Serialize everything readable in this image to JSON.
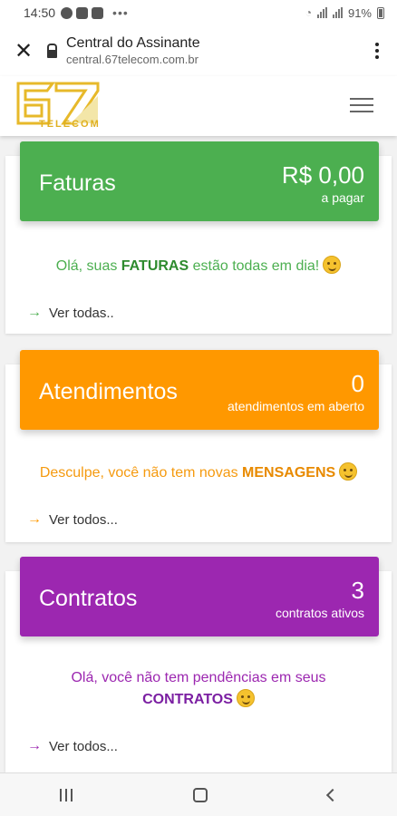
{
  "statusbar": {
    "time": "14:50",
    "battery": "91%"
  },
  "browser": {
    "title": "Central do Assinante",
    "url": "central.67telecom.com.br"
  },
  "logo": {
    "number": "67",
    "text": "TELECOM"
  },
  "cards": {
    "faturas": {
      "title": "Faturas",
      "value": "R$ 0,00",
      "sub": "a pagar",
      "msg_before": "Olá, suas ",
      "msg_strong": "FATURAS",
      "msg_after": " estão todas em dia!",
      "link": "Ver todas..",
      "color": "#4caf50",
      "text_color": "#4caf50"
    },
    "atendimentos": {
      "title": "Atendimentos",
      "value": "0",
      "sub": "atendimentos em aberto",
      "msg_before": "Desculpe, você não tem novas ",
      "msg_strong": "MENSAGENS",
      "msg_after": "",
      "link": "Ver todos...",
      "color": "#ff9800",
      "text_color": "#f59a0f"
    },
    "contratos": {
      "title": "Contratos",
      "value": "3",
      "sub": "contratos ativos",
      "msg_before": "Olá, você não tem pendências em seus",
      "msg_strong": "CONTRATOS",
      "msg_after": "",
      "link": "Ver todos...",
      "color": "#9c27b0",
      "text_color": "#9c27b0"
    }
  }
}
